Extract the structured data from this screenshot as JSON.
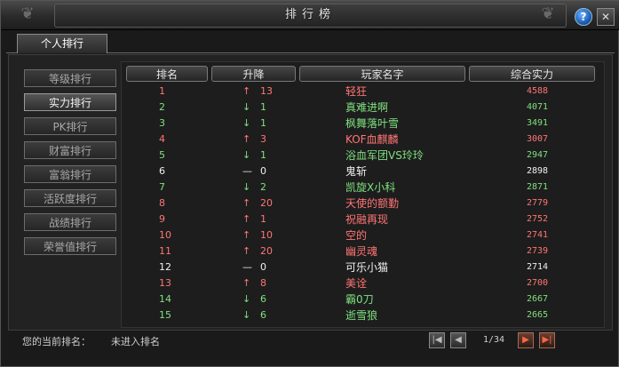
{
  "window": {
    "title": "排行榜"
  },
  "tab": {
    "label": "个人排行"
  },
  "sidebar": {
    "items": [
      {
        "label": "等级排行",
        "active": false
      },
      {
        "label": "实力排行",
        "active": true
      },
      {
        "label": "PK排行",
        "active": false
      },
      {
        "label": "财富排行",
        "active": false
      },
      {
        "label": "富翁排行",
        "active": false
      },
      {
        "label": "活跃度排行",
        "active": false
      },
      {
        "label": "战绩排行",
        "active": false
      },
      {
        "label": "荣誉值排行",
        "active": false
      }
    ]
  },
  "table": {
    "headers": {
      "rank": "排名",
      "change": "升降",
      "name": "玩家名字",
      "power": "综合实力"
    },
    "rows": [
      {
        "rank": "1",
        "dir": "up",
        "delta": "13",
        "name": "轻狂",
        "power": "4588"
      },
      {
        "rank": "2",
        "dir": "down",
        "delta": "1",
        "name": "真难进啊",
        "power": "4071"
      },
      {
        "rank": "3",
        "dir": "down",
        "delta": "1",
        "name": "枫舞落叶雪",
        "power": "3491"
      },
      {
        "rank": "4",
        "dir": "up",
        "delta": "3",
        "name": "KOF血麒麟",
        "power": "3007"
      },
      {
        "rank": "5",
        "dir": "down",
        "delta": "1",
        "name": "浴血军团VS玲玲",
        "power": "2947"
      },
      {
        "rank": "6",
        "dir": "none",
        "delta": "0",
        "name": "鬼斩",
        "power": "2898"
      },
      {
        "rank": "7",
        "dir": "down",
        "delta": "2",
        "name": "凯旋X小科",
        "power": "2871"
      },
      {
        "rank": "8",
        "dir": "up",
        "delta": "20",
        "name": "天使的额勤",
        "power": "2779"
      },
      {
        "rank": "9",
        "dir": "up",
        "delta": "1",
        "name": "祝融再现",
        "power": "2752"
      },
      {
        "rank": "10",
        "dir": "up",
        "delta": "10",
        "name": "空的",
        "power": "2741"
      },
      {
        "rank": "11",
        "dir": "up",
        "delta": "20",
        "name": "幽灵魂",
        "power": "2739"
      },
      {
        "rank": "12",
        "dir": "none",
        "delta": "0",
        "name": "可乐小猫",
        "power": "2714"
      },
      {
        "rank": "13",
        "dir": "up",
        "delta": "8",
        "name": "美诠",
        "power": "2700"
      },
      {
        "rank": "14",
        "dir": "down",
        "delta": "6",
        "name": "霸0刀",
        "power": "2667"
      },
      {
        "rank": "15",
        "dir": "down",
        "delta": "6",
        "name": "逝雪狼",
        "power": "2665"
      }
    ]
  },
  "status": {
    "label": "您的当前排名：",
    "value": "未进入排名"
  },
  "pager": {
    "text": "1/34",
    "first": "|◀",
    "prev": "◀",
    "next": "▶",
    "last": "▶|"
  },
  "icons": {
    "up": "↑",
    "down": "↓",
    "none": "—",
    "help": "?",
    "close": "✕",
    "ornament": "❦"
  },
  "colors": {
    "up": "#ff7575",
    "down": "#7fe07f",
    "none": "#f0f0f0"
  }
}
